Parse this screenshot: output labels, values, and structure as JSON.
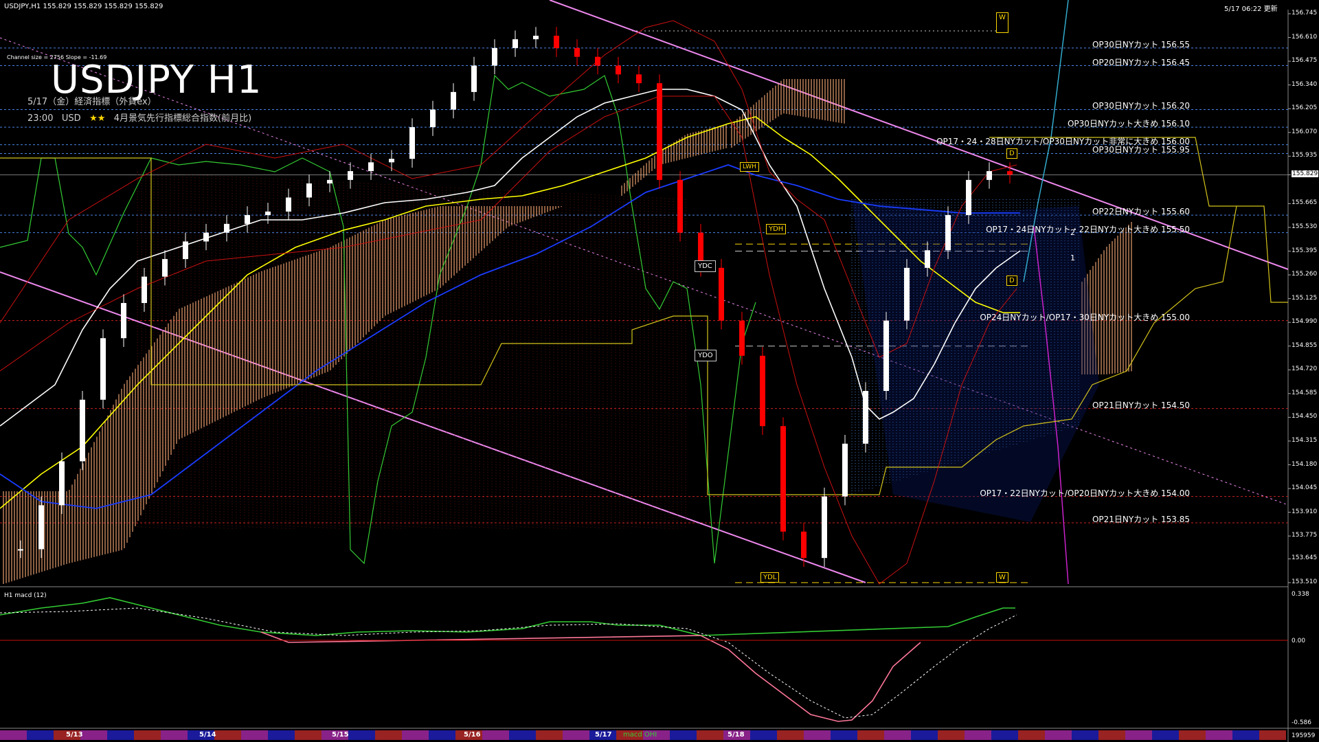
{
  "window": {
    "symbol_info": "USDJPY,H1  155.829 155.829 155.829 155.829",
    "update_time": "5/17 06:22 更新"
  },
  "title": "USDJPY H1",
  "channel_info": "Channel size = 2756 Slope = -11.69",
  "event": {
    "line1": "5/17（金）経済指標（外貨ex）",
    "line2_time": "23:00",
    "line2_ccy": "USD",
    "line2_stars": "★★",
    "line2_text": "4月景気先行指標総合指数(前月比)"
  },
  "price_axis": {
    "labels": [
      "156.745",
      "156.610",
      "156.475",
      "156.340",
      "156.205",
      "156.070",
      "155.935",
      "155.829",
      "155.665",
      "155.530",
      "155.395",
      "155.260",
      "155.125",
      "154.990",
      "154.855",
      "154.720",
      "154.585",
      "154.450",
      "154.315",
      "154.180",
      "154.045",
      "153.910",
      "153.775",
      "153.645",
      "153.510"
    ],
    "current": "155.829"
  },
  "levels": [
    {
      "label": "OP30日NYカット 156.55",
      "color": "#4a86e8",
      "style": "dash"
    },
    {
      "label": "OP20日NYカット 156.45",
      "color": "#4a86e8",
      "style": "dash"
    },
    {
      "label": "OP30日NYカット 156.20",
      "color": "#4a86e8",
      "style": "dash"
    },
    {
      "label": "OP30日NYカット大きめ 156.10",
      "color": "#4a86e8",
      "style": "dash"
    },
    {
      "label": "OP17・24・28日NYカット/OP30日NYカット非常に大きめ 156.00",
      "color": "#4a86e8",
      "style": "dash"
    },
    {
      "label": "OP30日NYカット 155.95",
      "color": "#4a86e8",
      "style": "dash"
    },
    {
      "label": "OP22日NYカット 155.60",
      "color": "#4a86e8",
      "style": "dash"
    },
    {
      "label": "OP17・24日NYカット・22日NYカット大きめ 155.50",
      "color": "#4a86e8",
      "style": "dash"
    },
    {
      "label": "OP24日NYカット/OP17・30日NYカット大きめ 155.00",
      "color": "#cc2222",
      "style": "dash"
    },
    {
      "label": "OP21日NYカット 154.50",
      "color": "#cc2222",
      "style": "dash"
    },
    {
      "label": "OP17・22日NYカット/OP20日NYカット大きめ 154.00",
      "color": "#cc2222",
      "style": "dash"
    },
    {
      "label": "OP21日NYカット 153.85",
      "color": "#cc2222",
      "style": "dash"
    }
  ],
  "markers": {
    "ydh": "YDH",
    "ydc": "YDC",
    "ydo": "YDO",
    "ydl": "YDL",
    "lwh": "LWH",
    "w_top": "W",
    "w_bottom": "W",
    "d1": "D",
    "d2": "D",
    "num1": "1",
    "num2": "2"
  },
  "sub_window": {
    "title": "H1  macd (12)",
    "labels": [
      "0.338",
      "0.00",
      "-0.586"
    ],
    "footer_label": "195959"
  },
  "time_axis": {
    "dates": [
      "5/13",
      "5/14",
      "5/15",
      "5/16",
      "5/17",
      "5/18"
    ],
    "extra": "macd OHI"
  },
  "colors": {
    "background": "#000000",
    "bull_candle": "#ffffff",
    "bear_candle": "#ff0000",
    "ma_short": "#ffffff",
    "ma_mid": "#ffff00",
    "ma_long": "#1a3cff",
    "cloud_bull": "#ffb07a",
    "cloud_bear": "#4a86e8",
    "chikou": "#33cc33",
    "macd": "#33cc33",
    "macd_neg": "#ff7799",
    "channel": "#ee88ee"
  },
  "chart_data": {
    "type": "line",
    "series": [
      {
        "name": "USDJPY",
        "values": [
          153.7,
          153.95,
          154.2,
          154.55,
          154.9,
          155.1,
          155.25,
          155.35,
          155.45,
          155.5,
          155.55,
          155.6,
          155.62,
          155.7,
          155.78,
          155.8,
          155.85,
          155.9,
          155.92,
          156.1,
          156.2,
          156.3,
          156.45,
          156.55,
          156.6,
          156.62,
          156.55,
          156.5,
          156.45,
          156.4,
          156.35,
          155.8,
          155.5,
          155.3,
          155.0,
          154.8,
          154.4,
          153.8,
          153.65,
          154.0,
          154.3,
          154.6,
          155.0,
          155.3,
          155.4,
          155.6,
          155.8,
          155.85,
          155.83
        ]
      }
    ],
    "ylim": [
      153.51,
      156.745
    ]
  }
}
